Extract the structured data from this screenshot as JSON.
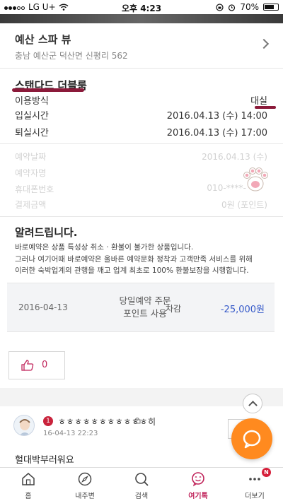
{
  "status_bar": {
    "carrier": "LG U+",
    "time": "오후 4:23",
    "battery_percent": "70%"
  },
  "hotel": {
    "name": "예산 스파 뷰",
    "address": "충남 예산군 덕산면 신평리 562"
  },
  "room": {
    "title": "스탠다드 더블룸",
    "rows": [
      {
        "label": "이용방식",
        "value": "대실"
      },
      {
        "label": "입실시간",
        "value": "2016.04.13 (수) 14:00"
      },
      {
        "label": "퇴실시간",
        "value": "2016.04.13 (수) 17:00"
      }
    ]
  },
  "reservation": {
    "rows": [
      {
        "label": "예약날짜",
        "value": "2016.04.13 (수)"
      },
      {
        "label": "예약자명",
        "value": ""
      },
      {
        "label": "휴대폰번호",
        "value": "010-****-"
      },
      {
        "label": "결제금액",
        "value": "0원 (포인트)"
      }
    ]
  },
  "notice": {
    "title": "알려드립니다.",
    "lines": [
      "바로예약은 상품 특성상 취소 · 환불이 불가한 상품입니다.",
      "그러나 여기어때 바로예약은 올바른 예약문화 정착과 고객만족 서비스를 위해",
      "이러한 숙박업계의 관행을 깨고 업계 최초로 100% 환불보장을 시행합니다."
    ]
  },
  "refund": {
    "date": "2016-04-13",
    "desc_line1": "당일예약 주문",
    "desc_line2": "포인트 사용",
    "type": "차감",
    "amount": "-25,000원"
  },
  "like": {
    "count": "0"
  },
  "comment": {
    "level": "1",
    "user": "ㅎㅎㅎㅎㅎㅎㅎㅎㅎㅎㅎ히",
    "time": "16-04-13 22:23",
    "text": "헐대박부러워요"
  },
  "bottom_nav": {
    "items": [
      {
        "label": "홈",
        "icon": "home-icon"
      },
      {
        "label": "내주변",
        "icon": "compass-icon"
      },
      {
        "label": "검색",
        "icon": "search-icon"
      },
      {
        "label": "여기톡",
        "icon": "talk-icon"
      },
      {
        "label": "더보기",
        "icon": "more-icon"
      }
    ],
    "more_badge": "N",
    "active_index": 3
  },
  "colors": {
    "accent": "#c0235a",
    "fab": "#ff8a1f",
    "amount_blue": "#3559c9",
    "marker": "#8b1a3a"
  }
}
